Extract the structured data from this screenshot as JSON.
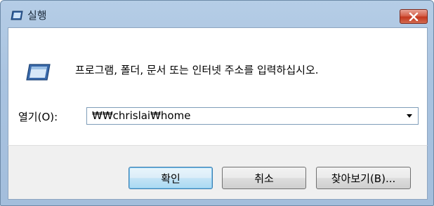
{
  "window": {
    "title": "실행",
    "icon": "run-icon",
    "close_icon": "close-icon"
  },
  "main": {
    "prompt": "프로그램, 폴더, 문서 또는 인터넷 주소를 입력하십시오.",
    "open_label": "열기(O):",
    "open_value": "₩₩chrislai₩home"
  },
  "buttons": {
    "ok": "확인",
    "cancel": "취소",
    "browse": "찾아보기(B)..."
  },
  "colors": {
    "titlebar": "#a9c3e0",
    "close_button": "#c4381f",
    "default_button_border": "#3c7fb1"
  }
}
